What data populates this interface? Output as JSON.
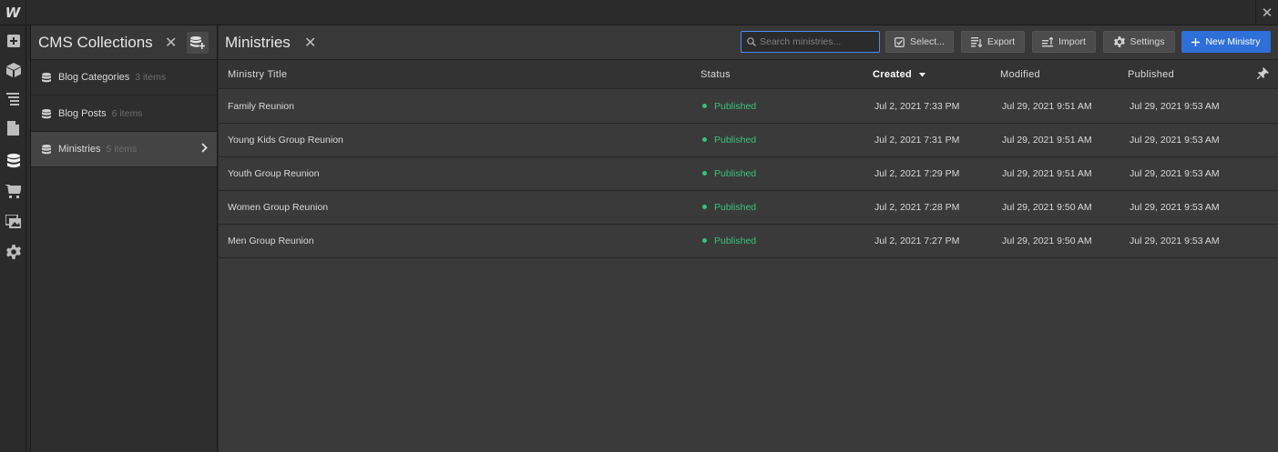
{
  "app": {
    "logo_letter": "W"
  },
  "rail": {
    "icons": [
      "add-panel-icon",
      "box-icon",
      "navigator-icon",
      "pages-icon",
      "cms-database-icon",
      "ecommerce-cart-icon",
      "assets-icon",
      "settings-gear-icon"
    ],
    "active": "cms-database-icon"
  },
  "collections_panel": {
    "title": "CMS Collections",
    "items": [
      {
        "name": "Blog Categories",
        "count": "3 items",
        "active": false
      },
      {
        "name": "Blog Posts",
        "count": "6 items",
        "active": false
      },
      {
        "name": "Ministries",
        "count": "5 items",
        "active": true
      }
    ]
  },
  "main": {
    "title": "Ministries",
    "search_placeholder": "Search ministries...",
    "toolbar": {
      "select_label": "Select...",
      "export_label": "Export",
      "import_label": "Import",
      "settings_label": "Settings",
      "new_label": "New Ministry"
    },
    "columns": [
      "Ministry Title",
      "Status",
      "Created",
      "Modified",
      "Published"
    ],
    "sorted_column": "Created",
    "rows": [
      {
        "title": "Family Reunion",
        "status": "Published",
        "created": "Jul 2, 2021 7:33 PM",
        "modified": "Jul 29, 2021 9:51 AM",
        "published": "Jul 29, 2021 9:53 AM"
      },
      {
        "title": "Young Kids Group Reunion",
        "status": "Published",
        "created": "Jul 2, 2021 7:31 PM",
        "modified": "Jul 29, 2021 9:51 AM",
        "published": "Jul 29, 2021 9:53 AM"
      },
      {
        "title": "Youth Group Reunion",
        "status": "Published",
        "created": "Jul 2, 2021 7:29 PM",
        "modified": "Jul 29, 2021 9:51 AM",
        "published": "Jul 29, 2021 9:53 AM"
      },
      {
        "title": "Women Group Reunion",
        "status": "Published",
        "created": "Jul 2, 2021 7:28 PM",
        "modified": "Jul 29, 2021 9:50 AM",
        "published": "Jul 29, 2021 9:53 AM"
      },
      {
        "title": "Men Group Reunion",
        "status": "Published",
        "created": "Jul 2, 2021 7:27 PM",
        "modified": "Jul 29, 2021 9:50 AM",
        "published": "Jul 29, 2021 9:53 AM"
      }
    ]
  },
  "colors": {
    "accent": "#2e6fd8",
    "published_status": "#39c27a",
    "panel_bg": "#2e2e2e",
    "table_bg": "#3a3a3a"
  }
}
